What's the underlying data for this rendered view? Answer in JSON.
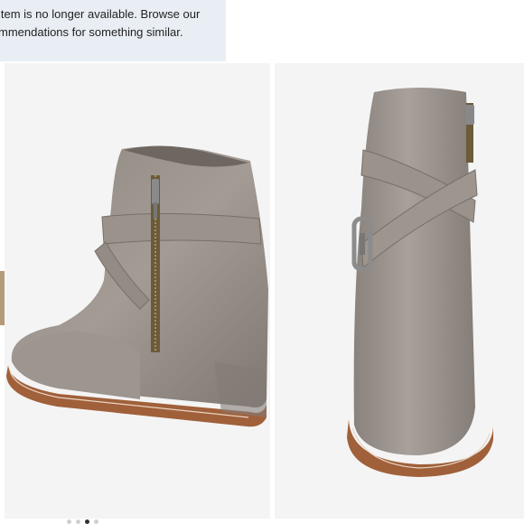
{
  "notice": {
    "line1": "item is no longer available. Browse our",
    "line2": "mmendations for something similar."
  },
  "carousel": {
    "dots": [
      {
        "active": false
      },
      {
        "active": false
      },
      {
        "active": true
      },
      {
        "active": false
      }
    ]
  },
  "colors": {
    "notice_background": "#e8eef4",
    "suede": "#928a84",
    "sole": "#a0603a",
    "panel_background": "#f4f4f4"
  },
  "images": {
    "left": "boot-side-view-with-zipper",
    "right": "boot-back-view-with-crossed-strap"
  }
}
